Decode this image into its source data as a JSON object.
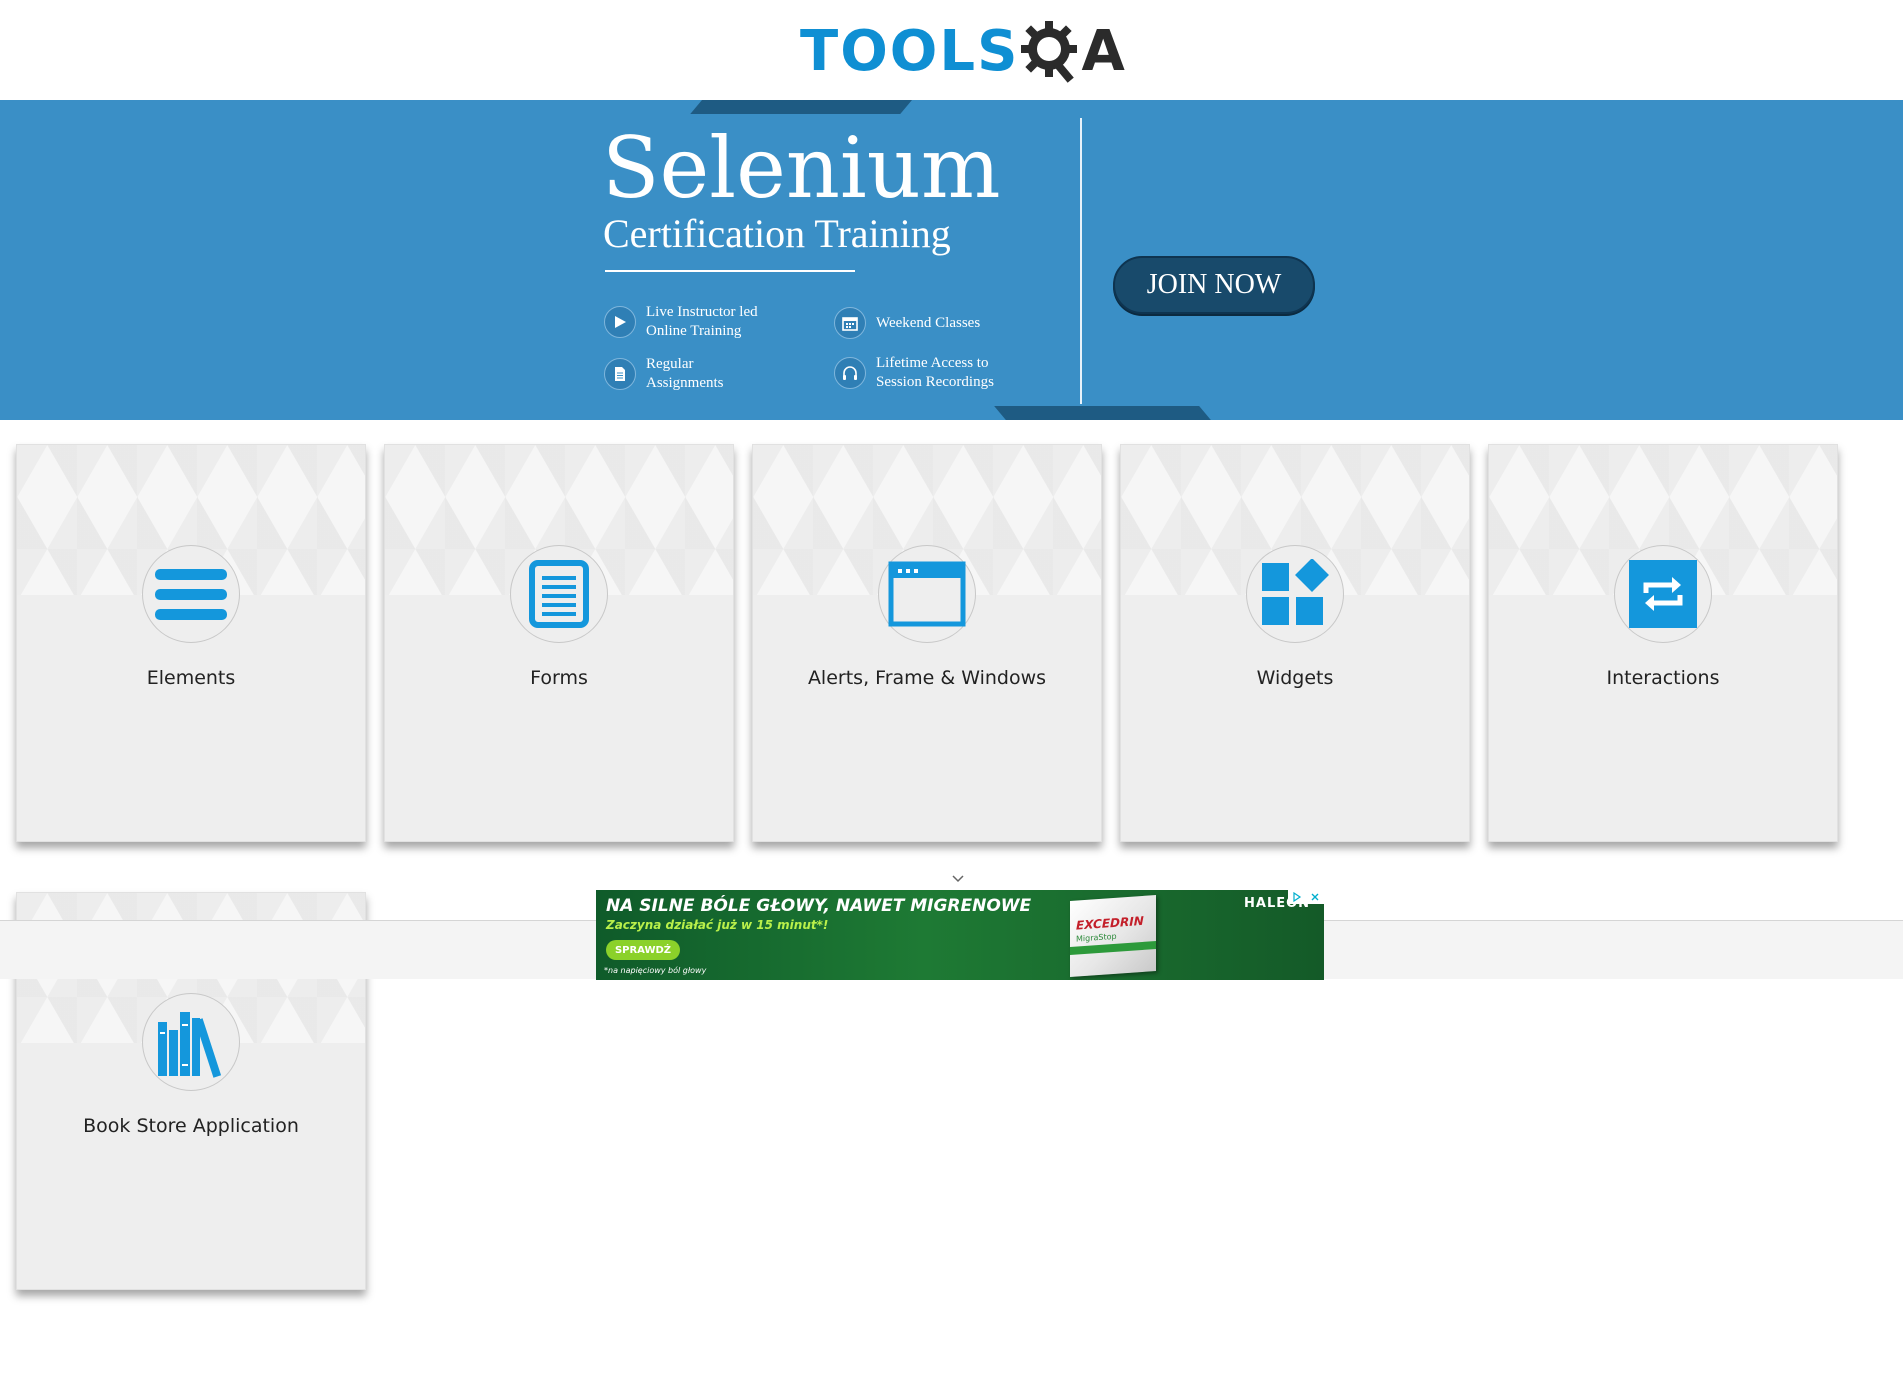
{
  "header": {
    "logo_text": "TOOLS",
    "logo_text_2": "A"
  },
  "banner": {
    "title": "Selenium",
    "subtitle": "Certification Training",
    "features": [
      {
        "icon": "play-icon",
        "line1": "Live Instructor led",
        "line2": "Online Training"
      },
      {
        "icon": "calendar-icon",
        "line1": "Weekend Classes",
        "line2": ""
      },
      {
        "icon": "document-icon",
        "line1": "Regular",
        "line2": "Assignments"
      },
      {
        "icon": "headphones-icon",
        "line1": "Lifetime Access to",
        "line2": "Session Recordings"
      }
    ],
    "cta": "JOIN NOW"
  },
  "cards": [
    {
      "label": "Elements",
      "icon": "hamburger-icon"
    },
    {
      "label": "Forms",
      "icon": "form-icon"
    },
    {
      "label": "Alerts, Frame & Windows",
      "icon": "window-icon"
    },
    {
      "label": "Widgets",
      "icon": "widgets-icon"
    },
    {
      "label": "Interactions",
      "icon": "swap-icon"
    },
    {
      "label": "Book Store Application",
      "icon": "books-icon"
    }
  ],
  "ad": {
    "headline": "NA SILNE BÓLE GŁOWY, NAWET MIGRENOWE",
    "subline": "Zaczyna działać już w 15 minut*!",
    "button": "SPRAWDŹ",
    "footnote": "*na napięciowy ból głowy",
    "brand": "HALEON",
    "product": "EXCEDRIN",
    "product_sub": "MigraStop"
  },
  "colors": {
    "accent": "#0f8fd3",
    "banner": "#3a8fc6",
    "icon_blue": "#1497dc"
  }
}
